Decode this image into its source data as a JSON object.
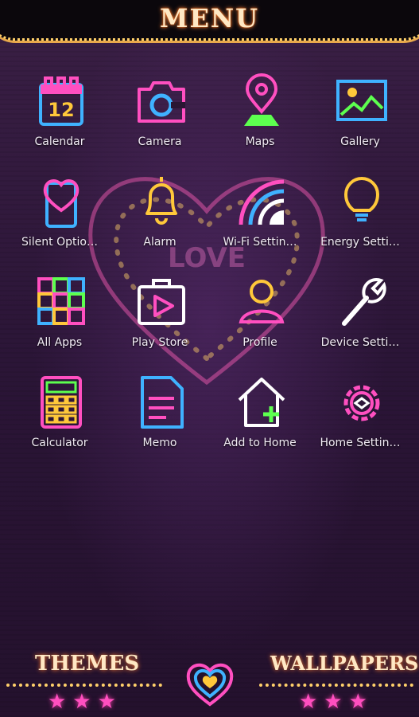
{
  "header": {
    "title": "MENU"
  },
  "apps": [
    {
      "label": "Calendar",
      "icon": "calendar-icon",
      "calendar_day": "12"
    },
    {
      "label": "Camera",
      "icon": "camera-icon"
    },
    {
      "label": "Maps",
      "icon": "map-pin-icon"
    },
    {
      "label": "Gallery",
      "icon": "gallery-icon"
    },
    {
      "label": "Silent Optio…",
      "icon": "phone-heart-icon"
    },
    {
      "label": "Alarm",
      "icon": "bell-icon"
    },
    {
      "label": "Wi-Fi Settin…",
      "icon": "wifi-icon"
    },
    {
      "label": "Energy Setti…",
      "icon": "lightbulb-icon"
    },
    {
      "label": "All Apps",
      "icon": "grid-icon"
    },
    {
      "label": "Play Store",
      "icon": "play-store-icon"
    },
    {
      "label": "Profile",
      "icon": "profile-icon"
    },
    {
      "label": "Device Setti…",
      "icon": "wrench-icon"
    },
    {
      "label": "Calculator",
      "icon": "calculator-icon"
    },
    {
      "label": "Memo",
      "icon": "memo-icon"
    },
    {
      "label": "Add to Home",
      "icon": "add-home-icon"
    },
    {
      "label": "Home Settin…",
      "icon": "home-settings-icon"
    }
  ],
  "background": {
    "heart_text": "LOVE"
  },
  "footer": {
    "themes_label": "THEMES",
    "wallpapers_label": "WALLPAPERS",
    "themes_stars": "★★★",
    "wallpapers_stars": "★★★"
  },
  "colors": {
    "pink": "#ff4fc0",
    "blue": "#3fb2ff",
    "yellow": "#ffc83a",
    "green": "#5dff4f",
    "gold": "#ffd06a"
  }
}
